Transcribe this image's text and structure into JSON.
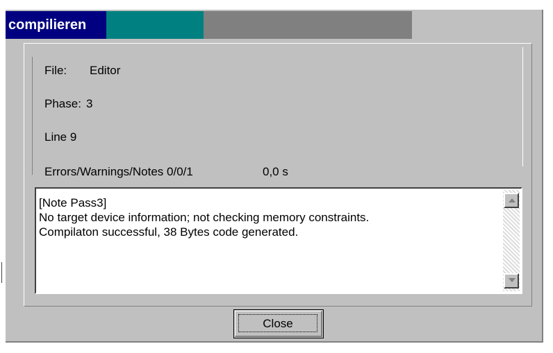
{
  "dialog": {
    "title": "compilieren",
    "progress_fraction": 0.32
  },
  "info": {
    "file_label": "File:",
    "file_value": "Editor",
    "phase_label": "Phase:",
    "phase_value": "3",
    "line_text": "Line 9",
    "counts_text": "Errors/Warnings/Notes 0/0/1",
    "time_text": "0,0 s"
  },
  "messages": {
    "lines": [
      "[Note Pass3]",
      "No target device information; not checking memory constraints.",
      "Compilaton successful, 38 Bytes code generated."
    ]
  },
  "buttons": {
    "close_label": "Close"
  },
  "icons": {
    "scroll_up": "scroll-up-arrow-icon",
    "scroll_down": "scroll-down-arrow-icon"
  },
  "colors": {
    "title_bg": "#000080",
    "progress": "#008080",
    "dialog_bg": "#c0c0c0"
  }
}
